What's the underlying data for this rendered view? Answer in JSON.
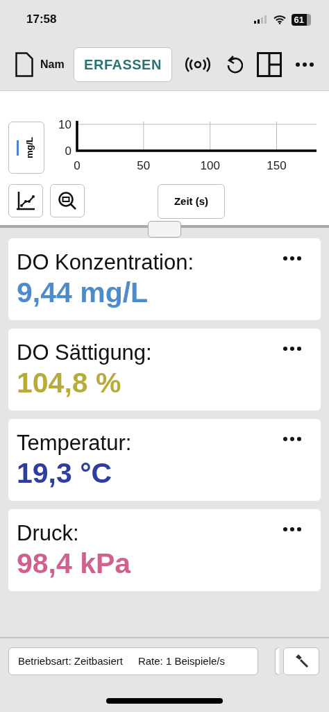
{
  "status_bar": {
    "time": "17:58",
    "battery": "61"
  },
  "toolbar": {
    "file_name": "Nam",
    "capture_button": "ERFASSEN"
  },
  "graph": {
    "y_axis_button": {
      "label": "mg/L",
      "color": "#4a86c8"
    },
    "x_axis_button": "Zeit (s)",
    "chart_data": {
      "type": "line",
      "xlim": [
        0,
        180
      ],
      "ylim": [
        0,
        10
      ],
      "xticks": [
        0,
        50,
        100,
        150
      ],
      "yticks": [
        0,
        10
      ],
      "grid": true
    }
  },
  "meters": [
    {
      "label": "DO Konzentration:",
      "value": "9,44 mg/L",
      "color": "#4e8bcb"
    },
    {
      "label": "DO Sättigung:",
      "value": "104,8 %",
      "color": "#b5ac3a"
    },
    {
      "label": "Temperatur:",
      "value": "19,3 °C",
      "color": "#2f3e9e"
    },
    {
      "label": "Druck:",
      "value": "98,4 kPa",
      "color": "#d0608f"
    }
  ],
  "footer": {
    "mode": "Betriebsart: Zeitbasiert",
    "rate": "Rate: 1 Beispiele/s"
  }
}
